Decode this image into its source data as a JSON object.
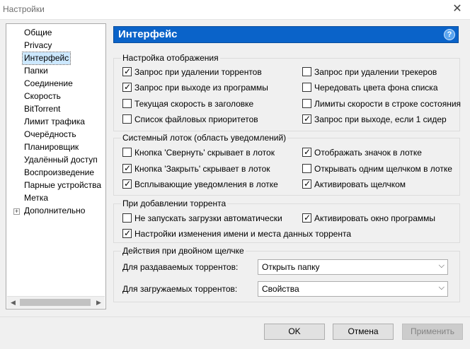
{
  "window": {
    "title": "Настройки"
  },
  "sidebar": {
    "items": [
      {
        "label": "Общие"
      },
      {
        "label": "Privacy"
      },
      {
        "label": "Интерфейс",
        "selected": true
      },
      {
        "label": "Папки"
      },
      {
        "label": "Соединение"
      },
      {
        "label": "Скорость"
      },
      {
        "label": "BitTorrent"
      },
      {
        "label": "Лимит трафика"
      },
      {
        "label": "Очерёдность"
      },
      {
        "label": "Планировщик"
      },
      {
        "label": "Удалённый доступ"
      },
      {
        "label": "Воспроизведение"
      },
      {
        "label": "Парные устройства"
      },
      {
        "label": "Метка"
      },
      {
        "label": "Дополнительно",
        "expandable": true
      }
    ]
  },
  "header": {
    "title": "Интерфейс",
    "help_glyph": "?"
  },
  "display_group": {
    "legend": "Настройка отображения",
    "left": [
      {
        "label": "Запрос при удалении торрентов",
        "checked": true
      },
      {
        "label": "Запрос при выходе из программы",
        "checked": true
      },
      {
        "label": "Текущая скорость в заголовке",
        "checked": false
      },
      {
        "label": "Список файловых приоритетов",
        "checked": false
      }
    ],
    "right": [
      {
        "label": "Запрос при удалении трекеров",
        "checked": false
      },
      {
        "label": "Чередовать цвета фона списка",
        "checked": false
      },
      {
        "label": "Лимиты скорости в строке состояния",
        "checked": false
      },
      {
        "label": "Запрос при выходе, если 1 сидер",
        "checked": true
      }
    ]
  },
  "tray_group": {
    "legend": "Системный лоток (область уведомлений)",
    "left": [
      {
        "label": "Кнопка 'Свернуть' скрывает в лоток",
        "checked": false
      },
      {
        "label": "Кнопка 'Закрыть' скрывает в лоток",
        "checked": true
      },
      {
        "label": "Всплывающие уведомления в лотке",
        "checked": true
      }
    ],
    "right": [
      {
        "label": "Отображать значок в лотке",
        "checked": true
      },
      {
        "label": "Открывать одним щелчком в лотке",
        "checked": false
      },
      {
        "label": "Активировать щелчком",
        "checked": true
      }
    ]
  },
  "add_group": {
    "legend": "При добавлении торрента",
    "no_autostart": {
      "label": "Не запускать загрузки автоматически",
      "checked": false
    },
    "activate_window": {
      "label": "Активировать окно программы",
      "checked": true
    },
    "rename_settings": {
      "label": "Настройки изменения имени и места данных торрента",
      "checked": true
    }
  },
  "dblclick_group": {
    "legend": "Действия при двойном щелчке",
    "seeding": {
      "label": "Для раздаваемых торрентов:",
      "value": "Открыть папку"
    },
    "downloading": {
      "label": "Для загружаемых торрентов:",
      "value": "Свойства"
    }
  },
  "buttons": {
    "ok": "OK",
    "cancel": "Отмена",
    "apply": "Применить"
  },
  "glyphs": {
    "check": "✓",
    "chevron": "⌵",
    "close": "✕",
    "left": "◀",
    "right": "▶",
    "expand": "+"
  }
}
